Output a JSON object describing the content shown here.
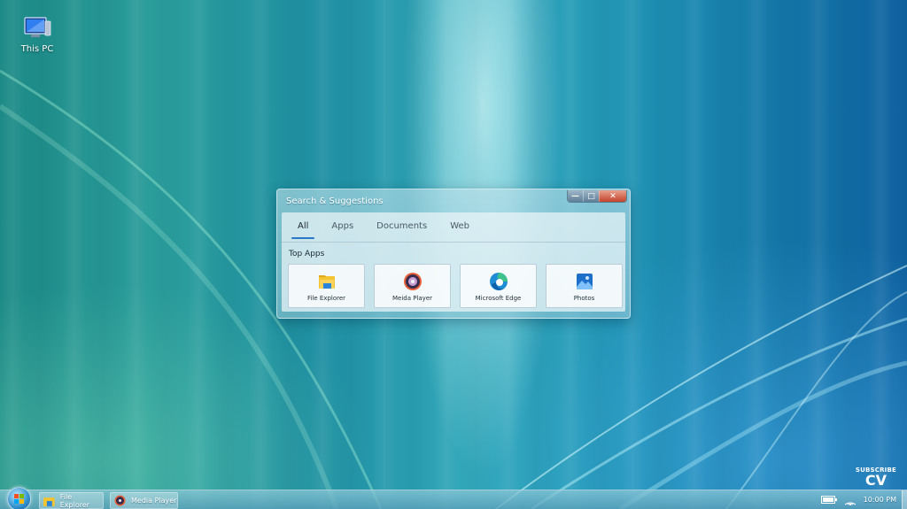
{
  "desktop": {
    "icons": [
      {
        "label": "This PC",
        "icon": "monitor-icon"
      }
    ]
  },
  "window": {
    "title": "Search & Suggestions",
    "controls": {
      "minimize": "—",
      "maximize": "□",
      "close": "✕"
    },
    "tabs": [
      {
        "label": "All",
        "active": true
      },
      {
        "label": "Apps",
        "active": false
      },
      {
        "label": "Documents",
        "active": false
      },
      {
        "label": "Web",
        "active": false
      }
    ],
    "section_title": "Top Apps",
    "apps": [
      {
        "label": "File Explorer",
        "icon": "folder-icon"
      },
      {
        "label": "Meida Player",
        "icon": "media-disc-icon"
      },
      {
        "label": "Microsoft Edge",
        "icon": "edge-icon"
      },
      {
        "label": "Photos",
        "icon": "photos-icon"
      }
    ]
  },
  "taskbar": {
    "start_icon": "windows-orb-icon",
    "items": [
      {
        "label": "File Explorer",
        "icon": "folder-icon"
      },
      {
        "label": "Media Player",
        "icon": "media-disc-icon"
      }
    ],
    "tray": {
      "battery_icon": "battery-icon",
      "wifi_icon": "wifi-icon",
      "clock": "10:00 PM"
    }
  },
  "watermark": {
    "text": "SUBSCRIBE",
    "logo": "CV"
  },
  "colors": {
    "accent": "#2a78c8",
    "close": "#c2432c"
  }
}
